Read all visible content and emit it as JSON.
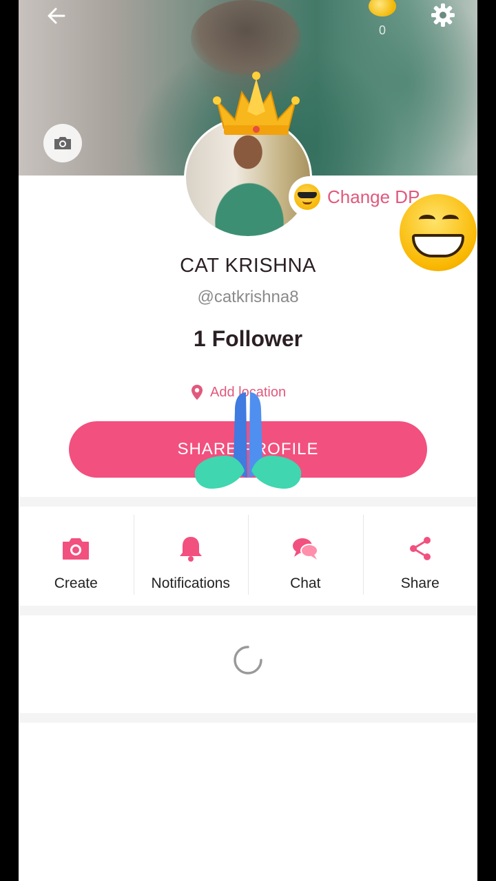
{
  "header": {
    "coin_count": "0"
  },
  "profile": {
    "change_dp_label": "Change DP",
    "name": "CAT KRISHNA",
    "handle": "@catkrishna8",
    "followers": "1 Follower",
    "location_label": "Add location",
    "share_profile_label": "SHARE PROFILE"
  },
  "actions": [
    {
      "label": "Create",
      "icon": "camera-icon"
    },
    {
      "label": "Notifications",
      "icon": "bell-icon"
    },
    {
      "label": "Chat",
      "icon": "chat-icon"
    },
    {
      "label": "Share",
      "icon": "share-icon"
    }
  ],
  "colors": {
    "accent": "#f2507e",
    "accent_text": "#e2587c"
  }
}
